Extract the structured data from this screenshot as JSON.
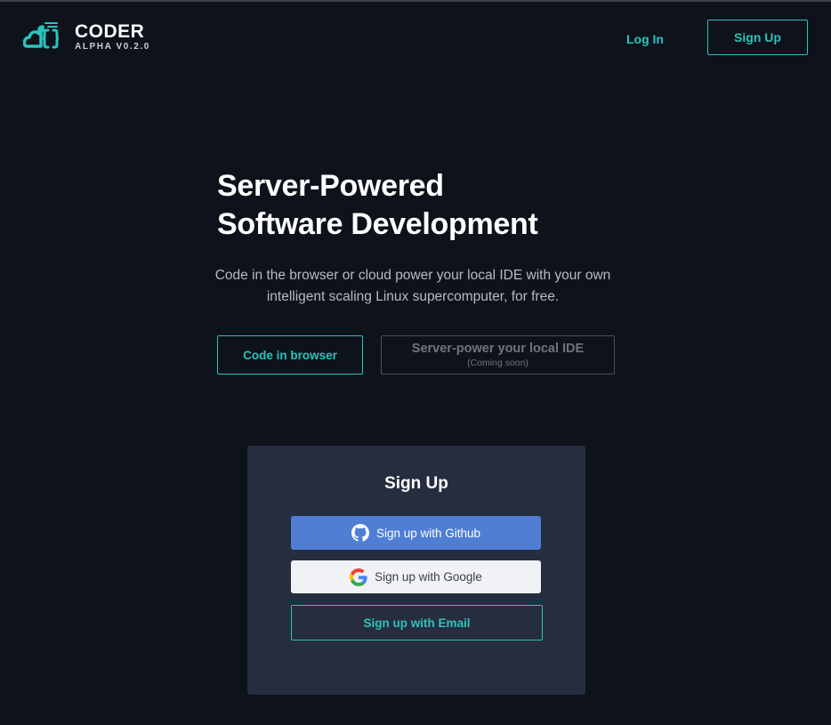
{
  "header": {
    "logo_name": "CODER",
    "logo_version": "ALPHA V0.2.0",
    "login_label": "Log In",
    "signup_label": "Sign Up"
  },
  "hero": {
    "title_line1": "Server-Powered",
    "title_line2": "Software Development",
    "subtitle": "Code in the browser or cloud power your local IDE with your own intelligent scaling Linux supercomputer, for free.",
    "browser_button_label": "Code in browser",
    "ide_button_label": "Server-power your local IDE",
    "ide_button_note": "(Coming soon)"
  },
  "signup_card": {
    "title": "Sign Up",
    "github_label": "Sign up with Github",
    "google_label": "Sign up with Google",
    "email_label": "Sign up with Email",
    "icons": {
      "github": "github-icon",
      "google": "google-icon"
    }
  },
  "colors": {
    "background": "#0d121b",
    "accent": "#2bc3bb",
    "card": "#262d3e",
    "github_button": "#4f7ed4",
    "google_button": "#f1f2f6"
  }
}
